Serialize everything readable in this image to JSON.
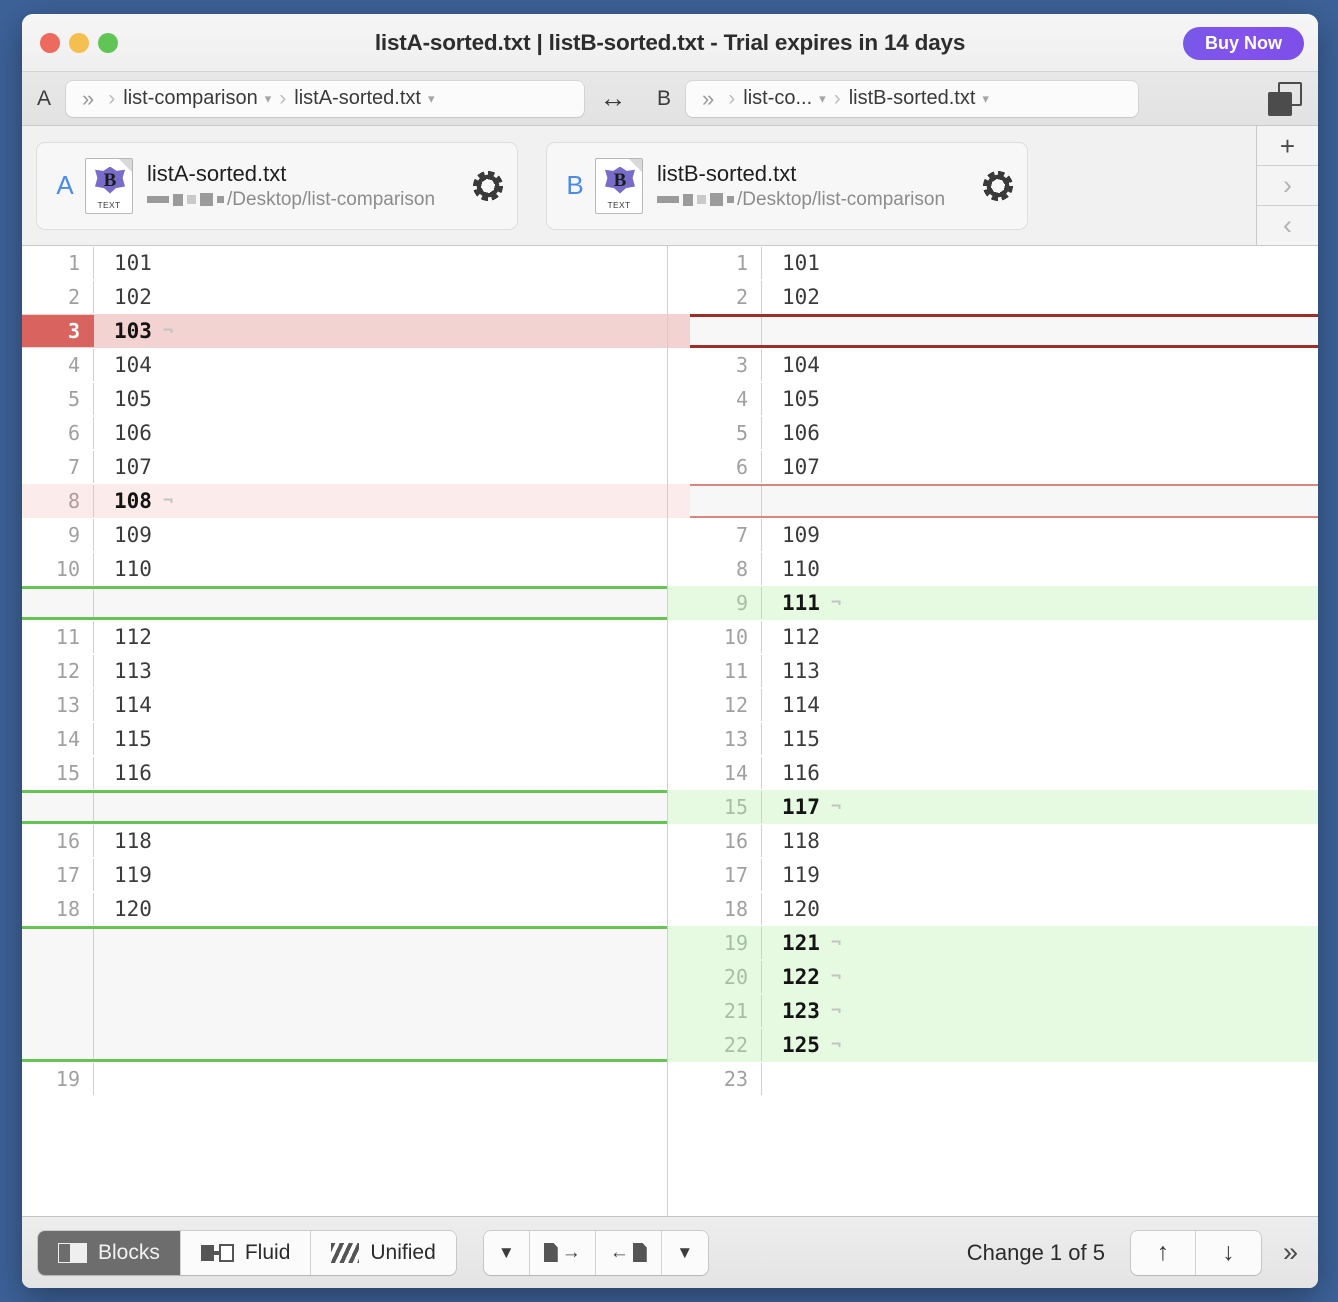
{
  "window": {
    "title": "listA-sorted.txt | listB-sorted.txt - Trial expires in 14 days",
    "buy_now_label": "Buy Now",
    "traffic_lights": [
      "close",
      "minimize",
      "maximize"
    ],
    "accent_purple": "#7b4fe8",
    "desktop_background": "#3d6299"
  },
  "navbar": {
    "side_a_letter": "A",
    "side_b_letter": "B",
    "crumbs_a": [
      {
        "label": "»",
        "has_caret": false
      },
      {
        "label": "list-comparison",
        "has_caret": true
      },
      {
        "label": "listA-sorted.txt",
        "has_caret": true
      }
    ],
    "crumbs_b": [
      {
        "label": "»",
        "has_caret": false
      },
      {
        "label": "list-co...",
        "has_caret": true
      },
      {
        "label": "listB-sorted.txt",
        "has_caret": true
      }
    ],
    "swap_icon": "swap-sides-icon",
    "layout_icon": "layout-toggle-icon"
  },
  "files": {
    "a": {
      "badge": "A",
      "name": "listA-sorted.txt",
      "path": "/Desktop/list-comparison",
      "icon_type_label": "TEXT",
      "icon_letter": "B"
    },
    "b": {
      "badge": "B",
      "name": "listB-sorted.txt",
      "path": "/Desktop/list-comparison",
      "icon_type_label": "TEXT",
      "icon_letter": "B"
    }
  },
  "side_buttons": [
    {
      "name": "add-comparison-button",
      "glyph": "+"
    },
    {
      "name": "next-comparison-button",
      "glyph": "›"
    },
    {
      "name": "previous-comparison-button",
      "glyph": "‹"
    }
  ],
  "colors": {
    "current_change_gutter": "#d9635f",
    "current_change_row": "#f2d3d1",
    "deleted_row": "#fbeceb",
    "inserted_row": "#e5fae0",
    "placeholder_row": "#f7f7f7",
    "border_red_strong": "#9f2e28",
    "border_red_soft": "#d98681",
    "border_green": "#66c455"
  },
  "diff": {
    "eol_glyph": "¬",
    "pane_a": [
      {
        "num": "1",
        "text": "101",
        "state": "same",
        "eol": false
      },
      {
        "num": "2",
        "text": "102",
        "state": "same",
        "eol": false
      },
      {
        "num": "3",
        "text": "103",
        "state": "cur",
        "eol": true
      },
      {
        "num": "4",
        "text": "104",
        "state": "same",
        "eol": false
      },
      {
        "num": "5",
        "text": "105",
        "state": "same",
        "eol": false
      },
      {
        "num": "6",
        "text": "106",
        "state": "same",
        "eol": false
      },
      {
        "num": "7",
        "text": "107",
        "state": "same",
        "eol": false
      },
      {
        "num": "8",
        "text": "108",
        "state": "del",
        "eol": true
      },
      {
        "num": "9",
        "text": "109",
        "state": "same",
        "eol": false
      },
      {
        "num": "10",
        "text": "110",
        "state": "same",
        "eol": false
      },
      {
        "num": "",
        "text": "",
        "state": "ph-green",
        "eol": false
      },
      {
        "num": "11",
        "text": "112",
        "state": "same",
        "eol": false
      },
      {
        "num": "12",
        "text": "113",
        "state": "same",
        "eol": false
      },
      {
        "num": "13",
        "text": "114",
        "state": "same",
        "eol": false
      },
      {
        "num": "14",
        "text": "115",
        "state": "same",
        "eol": false
      },
      {
        "num": "15",
        "text": "116",
        "state": "same",
        "eol": false
      },
      {
        "num": "",
        "text": "",
        "state": "ph-green",
        "eol": false
      },
      {
        "num": "16",
        "text": "118",
        "state": "same",
        "eol": false
      },
      {
        "num": "17",
        "text": "119",
        "state": "same",
        "eol": false
      },
      {
        "num": "18",
        "text": "120",
        "state": "same",
        "eol": false
      },
      {
        "num": "",
        "text": "",
        "state": "ph-green-4",
        "eol": false
      },
      {
        "num": "19",
        "text": "",
        "state": "same",
        "eol": false
      }
    ],
    "pane_b": [
      {
        "num": "1",
        "text": "101",
        "state": "same",
        "eol": false
      },
      {
        "num": "2",
        "text": "102",
        "state": "same",
        "eol": false
      },
      {
        "num": "",
        "text": "",
        "state": "ph-red-strong",
        "eol": false
      },
      {
        "num": "3",
        "text": "104",
        "state": "same",
        "eol": false
      },
      {
        "num": "4",
        "text": "105",
        "state": "same",
        "eol": false
      },
      {
        "num": "5",
        "text": "106",
        "state": "same",
        "eol": false
      },
      {
        "num": "6",
        "text": "107",
        "state": "same",
        "eol": false
      },
      {
        "num": "",
        "text": "",
        "state": "ph-red-soft",
        "eol": false
      },
      {
        "num": "7",
        "text": "109",
        "state": "same",
        "eol": false
      },
      {
        "num": "8",
        "text": "110",
        "state": "same",
        "eol": false
      },
      {
        "num": "9",
        "text": "111",
        "state": "ins",
        "eol": true
      },
      {
        "num": "10",
        "text": "112",
        "state": "same",
        "eol": false
      },
      {
        "num": "11",
        "text": "113",
        "state": "same",
        "eol": false
      },
      {
        "num": "12",
        "text": "114",
        "state": "same",
        "eol": false
      },
      {
        "num": "13",
        "text": "115",
        "state": "same",
        "eol": false
      },
      {
        "num": "14",
        "text": "116",
        "state": "same",
        "eol": false
      },
      {
        "num": "15",
        "text": "117",
        "state": "ins",
        "eol": true
      },
      {
        "num": "16",
        "text": "118",
        "state": "same",
        "eol": false
      },
      {
        "num": "17",
        "text": "119",
        "state": "same",
        "eol": false
      },
      {
        "num": "18",
        "text": "120",
        "state": "same",
        "eol": false
      },
      {
        "num": "19",
        "text": "121",
        "state": "ins",
        "eol": true
      },
      {
        "num": "20",
        "text": "122",
        "state": "ins",
        "eol": true
      },
      {
        "num": "21",
        "text": "123",
        "state": "ins",
        "eol": true
      },
      {
        "num": "22",
        "text": "125",
        "state": "ins",
        "eol": true
      },
      {
        "num": "23",
        "text": "",
        "state": "same",
        "eol": false
      }
    ]
  },
  "bottombar": {
    "modes": [
      {
        "label": "Blocks",
        "icon": "blocks-icon",
        "active": true
      },
      {
        "label": "Fluid",
        "icon": "fluid-icon",
        "active": false
      },
      {
        "label": "Unified",
        "icon": "unified-icon",
        "active": false
      }
    ],
    "apply_buttons": [
      {
        "name": "apply-menu-left",
        "glyph": "▼"
      },
      {
        "name": "apply-to-right",
        "glyph": "doc-right"
      },
      {
        "name": "apply-to-left",
        "glyph": "doc-left"
      },
      {
        "name": "apply-menu-right",
        "glyph": "▼"
      }
    ],
    "change_status": "Change 1 of 5",
    "prev_change_glyph": "↑",
    "next_change_glyph": "↓",
    "more_glyph": "»"
  }
}
